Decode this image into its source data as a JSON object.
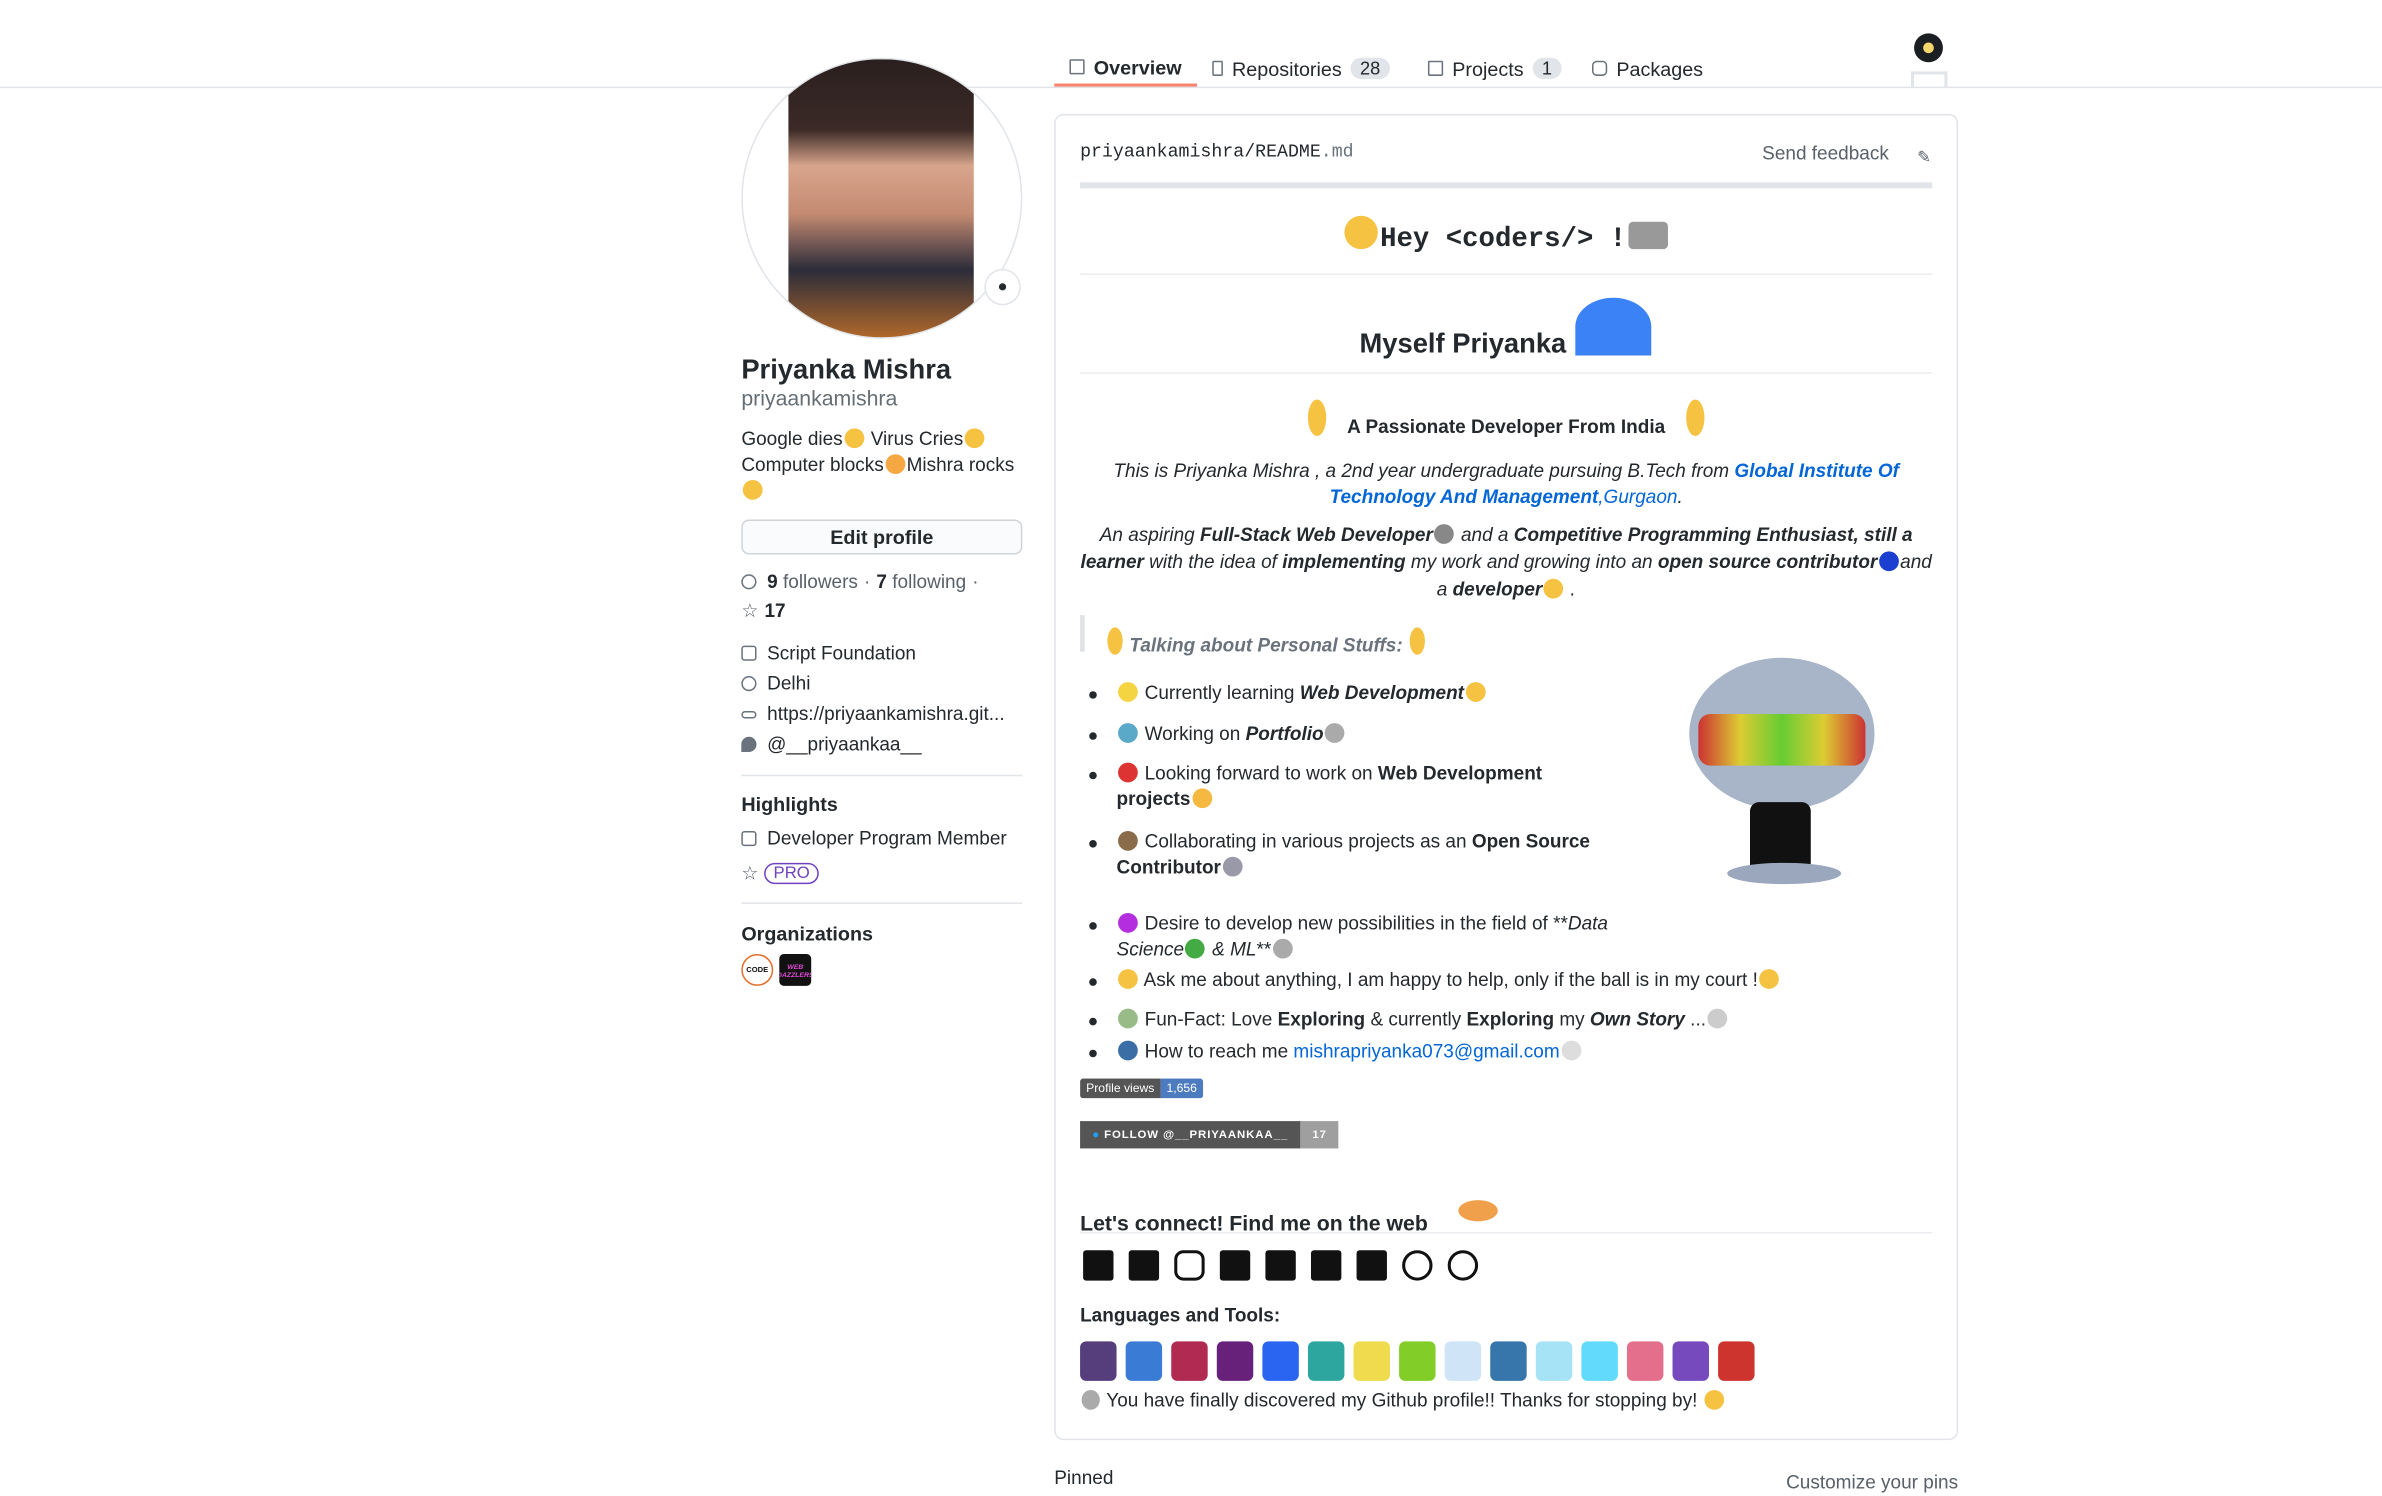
{
  "tabs": [
    {
      "label": "Overview",
      "icon": "book-icon"
    },
    {
      "label": "Repositories",
      "count": "28",
      "icon": "repo-icon"
    },
    {
      "label": "Projects",
      "count": "1",
      "icon": "project-icon"
    },
    {
      "label": "Packages",
      "icon": "package-icon"
    }
  ],
  "profile": {
    "name": "Priyanka Mishra",
    "username": "priyaankamishra",
    "bio": [
      {
        "t": "Google dies"
      },
      {
        "e": "pleading-face"
      },
      {
        "t": " Virus Cries"
      },
      {
        "e": "crying-face"
      },
      {
        "t": " Computer blocks"
      },
      {
        "e": "dizzy-face"
      },
      {
        "t": "Mishra rocks"
      },
      {
        "e": "sunglasses-face"
      }
    ],
    "edit_label": "Edit profile",
    "followers": "9",
    "followers_label": "followers",
    "following": "7",
    "following_label": "following",
    "stars": "17",
    "company": "Script Foundation",
    "location": "Delhi",
    "website": "https://priyaankamishra.git...",
    "twitter": "@__priyaankaa__"
  },
  "highlights": {
    "title": "Highlights",
    "member": "Developer Program Member",
    "badge": "PRO"
  },
  "organizations": {
    "title": "Organizations",
    "items": [
      "CODE",
      "WEB DAZZLERS"
    ]
  },
  "readme": {
    "path_user": "priyaankamishra",
    "sep": "/",
    "file": "README",
    "ext": ".md",
    "feedback": "Send feedback",
    "greeting": "Hey <coders/> !",
    "myself": "Myself Priyanka",
    "tagline": "A Passionate Developer From India",
    "intro": [
      {
        "t": "This is Priyanka Mishra , a 2nd year undergraduate pursuing B.Tech from ",
        "s": "i"
      },
      {
        "t": "Global Institute Of Technology And Management",
        "s": "bi link"
      },
      {
        "t": ",Gurgaon",
        "s": "i link"
      },
      {
        "t": ".",
        "s": "i"
      }
    ],
    "aspire": [
      {
        "t": "An aspiring ",
        "s": "i"
      },
      {
        "t": "Full-Stack Web Developer",
        "s": "bi"
      },
      {
        "e": "dev"
      },
      {
        "t": " and a ",
        "s": "i"
      },
      {
        "t": "Competitive Programming Enthusiast,",
        "s": "bi"
      },
      {
        "t": " still a learner",
        "s": "bi"
      },
      {
        "t": " with the idea of ",
        "s": "i"
      },
      {
        "t": "implementing",
        "s": "bi"
      },
      {
        "t": " my work and growing into an ",
        "s": "i"
      },
      {
        "t": "open source contributor",
        "s": "bi"
      },
      {
        "e": "rocket"
      },
      {
        "t": "and a ",
        "s": "i"
      },
      {
        "t": "developer",
        "s": "bi"
      },
      {
        "e": "medal"
      },
      {
        "t": " .",
        "s": "i"
      }
    ],
    "personal": "Talking about Personal Stuffs:",
    "items": [
      [
        {
          "e": "hand"
        },
        {
          "t": " Currently learning "
        },
        {
          "t": "Web Development",
          "s": "bi"
        },
        {
          "e": "wink"
        }
      ],
      [
        {
          "e": "wizard"
        },
        {
          "t": " Working on "
        },
        {
          "t": "Portfolio",
          "s": "bi"
        },
        {
          "e": "telescope"
        }
      ],
      [
        {
          "e": "mushroom"
        },
        {
          "t": " Looking forward to work on "
        },
        {
          "t": "Web Development projects",
          "s": "b"
        },
        {
          "e": "handshake"
        }
      ],
      [
        {
          "e": "hat"
        },
        {
          "t": " Collaborating in various projects as an "
        },
        {
          "t": "Open Source Contributor",
          "s": "b"
        },
        {
          "e": "octocat"
        }
      ],
      [
        {
          "e": "blob"
        },
        {
          "t": " Desire to develop new possibilities in the field of **"
        },
        {
          "t": "Data Science",
          "s": "i"
        },
        {
          "e": "seedling"
        },
        {
          "t": " & ML",
          "s": "i"
        },
        {
          "t": "**"
        },
        {
          "e": "telescope"
        }
      ],
      [
        {
          "e": "medal"
        },
        {
          "t": " Ask me about anything, I am happy to help, only if the ball is in my court !"
        },
        {
          "e": "zap"
        }
      ],
      [
        {
          "e": "explorer"
        },
        {
          "t": " Fun-Fact: Love "
        },
        {
          "t": "Exploring",
          "s": "b"
        },
        {
          "t": " & currently "
        },
        {
          "t": "Exploring",
          "s": "b"
        },
        {
          "t": " my "
        },
        {
          "t": "Own Story",
          "s": "bi"
        },
        {
          "t": " ..."
        },
        {
          "e": "memo"
        }
      ],
      [
        {
          "e": "mailbox"
        },
        {
          "t": " How to reach me "
        },
        {
          "t": "mishrapriyanka073@gmail.com",
          "s": "link"
        },
        {
          "e": "speech"
        }
      ]
    ],
    "views_label": "Profile views",
    "views": "1,656",
    "follow_label": "FOLLOW @__PRIYAANKAA__",
    "follow_count": "17",
    "connect": "Let's connect! Find me on the web",
    "social": [
      "twitter-icon",
      "linkedin-icon",
      "instagram-icon",
      "medium-icon",
      "youtube-icon",
      "codechef-icon",
      "hackerrank-icon",
      "leetcode-icon",
      "geeksforgeeks-icon"
    ],
    "tools_title": "Languages and Tools:",
    "tools": [
      {
        "n": "bootstrap",
        "c": "#563d7c"
      },
      {
        "n": "c",
        "c": "#3a7bd5"
      },
      {
        "n": "cplusplus",
        "c": "#b02a52"
      },
      {
        "n": "csharp",
        "c": "#68217a"
      },
      {
        "n": "css3",
        "c": "#2965f1"
      },
      {
        "n": "dart",
        "c": "#2ea6a0"
      },
      {
        "n": "javascript",
        "c": "#f0db4f"
      },
      {
        "n": "nodejs",
        "c": "#83cd29"
      },
      {
        "n": "photoshop",
        "c": "#cfe4f7"
      },
      {
        "n": "python",
        "c": "#3776ab"
      },
      {
        "n": "react",
        "c": "#a6e3f6"
      },
      {
        "n": "react-native",
        "c": "#61dafb"
      },
      {
        "n": "sass-gradient",
        "c": "#e36f8c"
      },
      {
        "n": "redux",
        "c": "#764abc"
      },
      {
        "n": "ruby",
        "c": "#cc342d"
      }
    ],
    "thanks": " You have finally discovered my Github profile!! Thanks for stopping by!"
  },
  "pinned": {
    "title": "Pinned",
    "customize": "Customize your pins"
  },
  "colors": {
    "accent": "#f9826c",
    "link": "#0366d6",
    "pro": "#6f42c1"
  }
}
